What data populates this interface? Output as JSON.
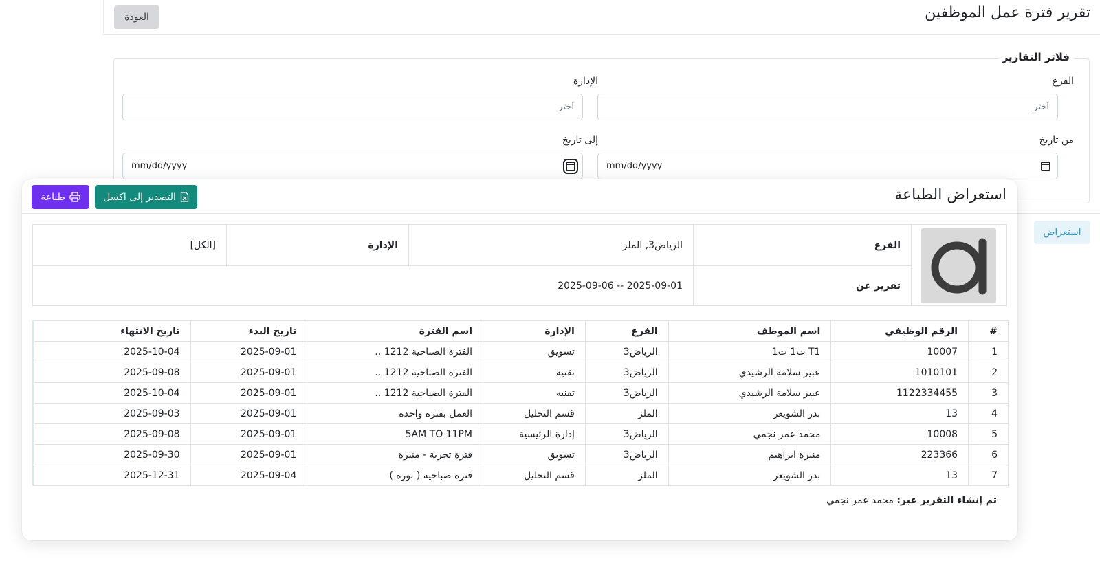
{
  "page": {
    "title": "تقرير فترة عمل الموظفين",
    "back_label": "العودة"
  },
  "filters": {
    "legend": "فلاتر التقارير",
    "branch_label": "الفرع",
    "branch_placeholder": "اختر",
    "department_label": "الإدارة",
    "department_placeholder": "اختر",
    "from_date_label": "من تاريخ",
    "from_date_value": "mm/dd/yyyy",
    "to_date_label": "إلى تاريخ",
    "to_date_value": "mm/dd/yyyy",
    "preview_label": "استعراض"
  },
  "preview": {
    "title": "استعراض الطباعة",
    "print_label": "طباعة",
    "excel_label": "التصدير إلى اكسل",
    "info": {
      "branch_label": "الفرع",
      "branch_value": "الرياض3, الملز",
      "department_label": "الإدارة",
      "department_value": "[الكل]",
      "report_for_label": "تقرير عن",
      "report_for_value": "2025-09-01 -- 2025-09-06"
    },
    "table": {
      "headers": [
        "#",
        "الرقم الوظيفي",
        "اسم الموظف",
        "الفرع",
        "الإدارة",
        "اسم الفترة",
        "تاريخ البدء",
        "تاريخ الانتهاء"
      ],
      "rows": [
        [
          "1",
          "10007",
          "T1 ت1 ت1",
          "الرياض3",
          "تسويق",
          "الفترة الصباحية 1212 ..",
          "2025-09-01",
          "2025-10-04"
        ],
        [
          "2",
          "1010101",
          "عبير سلامه الرشيدي",
          "الرياض3",
          "تقنيه",
          "الفترة الصباحية 1212 ..",
          "2025-09-01",
          "2025-09-08"
        ],
        [
          "3",
          "1122334455",
          "عبير سلامة الرشيدي",
          "الرياض3",
          "تقنيه",
          "الفترة الصباحية 1212 ..",
          "2025-09-01",
          "2025-10-04"
        ],
        [
          "4",
          "13",
          "بدر الشويعر",
          "الملز",
          "قسم التحليل",
          "العمل بفتره واحده",
          "2025-09-01",
          "2025-09-03"
        ],
        [
          "5",
          "10008",
          "محمد عمر نجمي",
          "الرياض3",
          "إدارة الرئيسية",
          "5AM TO 11PM",
          "2025-09-01",
          "2025-09-08"
        ],
        [
          "6",
          "223366",
          "منيرة ابراهيم",
          "الرياض3",
          "تسويق",
          "فترة تجربة - منيرة",
          "2025-09-01",
          "2025-09-30"
        ],
        [
          "7",
          "13",
          "بدر الشويعر",
          "الملز",
          "قسم التحليل",
          "فترة صباحية ( نوره )",
          "2025-09-04",
          "2025-12-31"
        ]
      ]
    },
    "footer_label": "تم إنشاء التقرير عبر:",
    "footer_value": "محمد عمر نجمي"
  },
  "colors": {
    "print_button": "#6f2fee",
    "excel_button": "#138a7c",
    "preview_button_bg": "#e6f4f9"
  }
}
